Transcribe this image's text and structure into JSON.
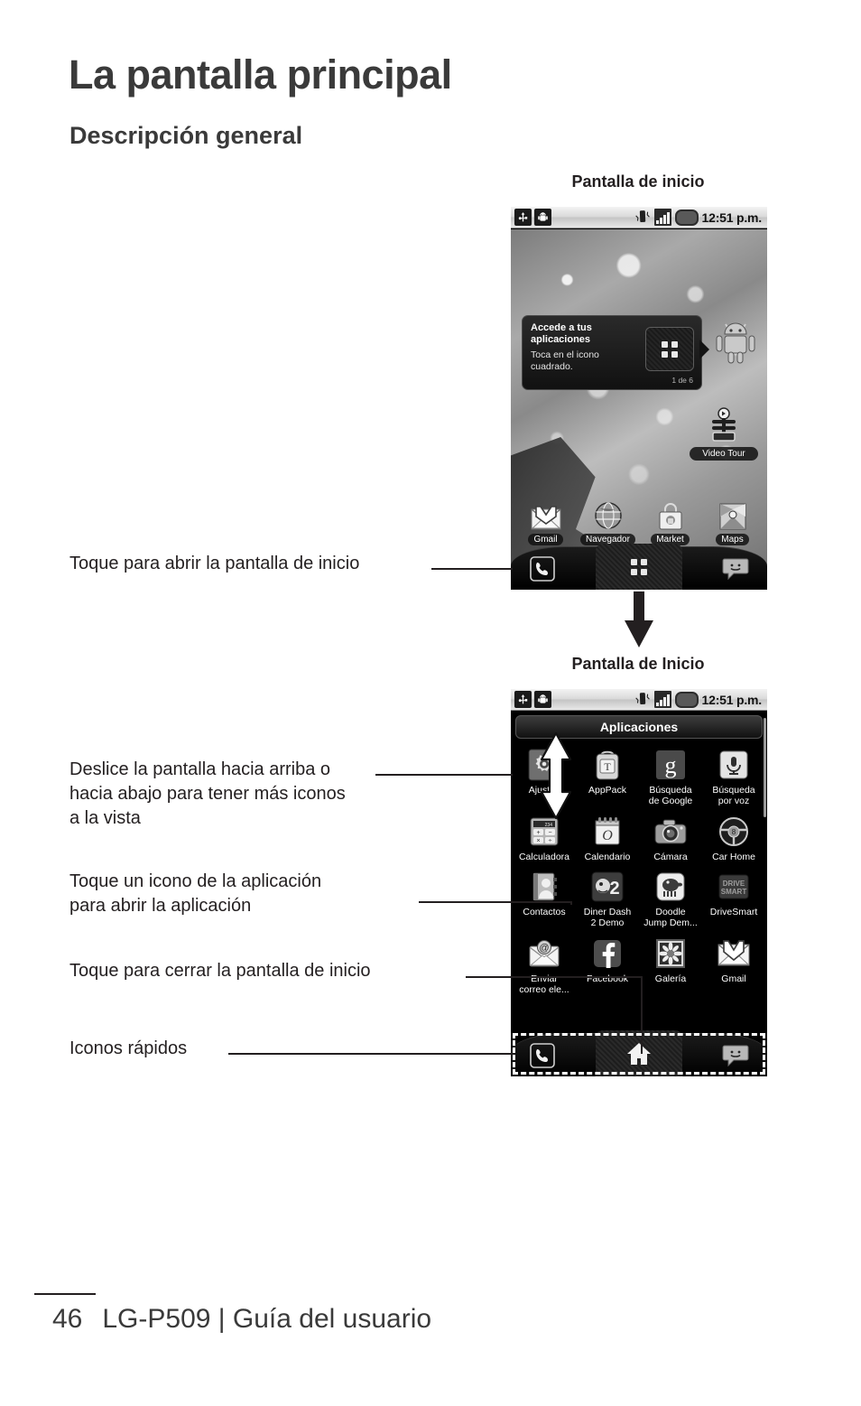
{
  "page": {
    "title": "La pantalla principal",
    "subtitle": "Descripción general",
    "footer_page_number": "46",
    "footer_text": "LG-P509 | Guía del usuario"
  },
  "figures": {
    "caption_top": "Pantalla de inicio",
    "caption_bottom": "Pantalla de Inicio"
  },
  "statusbar": {
    "time": "12:51 p.m.",
    "usb_icon": "usb-icon",
    "android_icon": "android-icon",
    "vibrate_icon": "vibrate-icon",
    "signal_icon": "signal-bars-icon",
    "battery_icon": "battery-icon"
  },
  "home_screen": {
    "tip": {
      "title": "Accede a tus\naplicaciones",
      "body": "Toca en el icono\ncuadrado.",
      "counter": "1 de 6"
    },
    "widget_label": "Video Tour",
    "apps": [
      {
        "label": "Gmail",
        "icon": "gmail-icon"
      },
      {
        "label": "Navegador",
        "icon": "browser-globe-icon"
      },
      {
        "label": "Market",
        "icon": "market-bag-icon"
      },
      {
        "label": "Maps",
        "icon": "maps-icon"
      }
    ],
    "dock": [
      {
        "name": "phone",
        "icon": "phone-handset-icon"
      },
      {
        "name": "launcher",
        "icon": "app-grid-icon"
      },
      {
        "name": "messaging",
        "icon": "messaging-smiley-icon"
      }
    ]
  },
  "apps_screen": {
    "title": "Aplicaciones",
    "apps": [
      {
        "label": "Ajustes",
        "icon": "settings-gear-icon"
      },
      {
        "label": "AppPack",
        "icon": "apppack-icon"
      },
      {
        "label": "Búsqueda\nde Google",
        "icon": "google-search-icon"
      },
      {
        "label": "Búsqueda\npor voz",
        "icon": "voice-search-mic-icon"
      },
      {
        "label": "Calculadora",
        "icon": "calculator-icon"
      },
      {
        "label": "Calendario",
        "icon": "calendar-icon"
      },
      {
        "label": "Cámara",
        "icon": "camera-icon"
      },
      {
        "label": "Car Home",
        "icon": "car-home-steering-icon"
      },
      {
        "label": "Contactos",
        "icon": "contacts-icon"
      },
      {
        "label": "Diner Dash\n2 Demo",
        "icon": "diner-dash-icon"
      },
      {
        "label": "Doodle\nJump Dem...",
        "icon": "doodle-jump-icon"
      },
      {
        "label": "DriveSmart",
        "icon": "drivesmart-icon"
      },
      {
        "label": "Enviar\ncorreo ele...",
        "icon": "email-icon"
      },
      {
        "label": "Facebook",
        "icon": "facebook-icon"
      },
      {
        "label": "Galería",
        "icon": "gallery-flower-icon"
      },
      {
        "label": "Gmail",
        "icon": "gmail-icon"
      }
    ],
    "dock": [
      {
        "name": "phone",
        "icon": "phone-handset-icon"
      },
      {
        "name": "home",
        "icon": "home-house-icon"
      },
      {
        "name": "messaging",
        "icon": "messaging-smiley-icon"
      }
    ]
  },
  "callouts": {
    "c1": "Toque para abrir la pantalla de inicio",
    "c2": "Deslice la pantalla hacia arriba o\nhacia abajo para tener más iconos\na la vista",
    "c3": "Toque un icono de la aplicación\npara abrir la aplicación",
    "c4": "Toque para cerrar la pantalla de inicio",
    "c5": "Iconos rápidos"
  },
  "colors": {
    "text": "#231f20",
    "heading": "#3a3a3a",
    "screen_bg": "#000000",
    "highlight": "#ffffff"
  }
}
